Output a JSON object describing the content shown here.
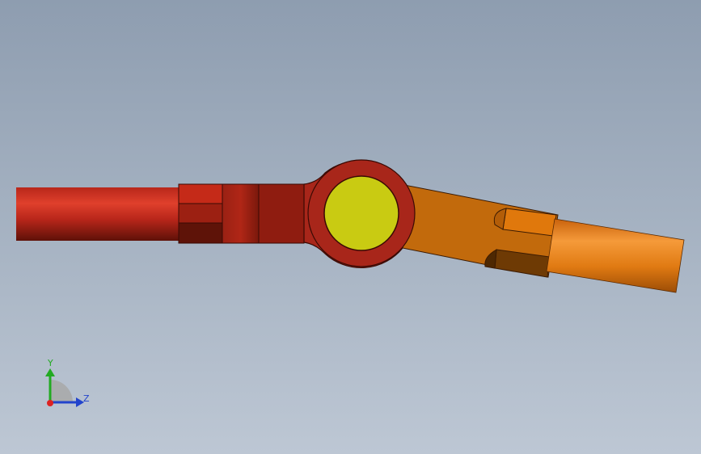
{
  "viewport": {
    "background_top": "#8e9db0",
    "background_bottom": "#bdc7d4"
  },
  "model": {
    "left_rod_color": "#c8281c",
    "left_clevis_color": "#a82316",
    "center_eye_color": "#a8261a",
    "ball_color": "#c9cb12",
    "right_link_color": "#c26a0c",
    "right_rod_color": "#e07a12"
  },
  "triad": {
    "y_label": "Y",
    "z_label": "Z",
    "y_color": "#22aa22",
    "z_color": "#2244cc",
    "origin_color": "#dd2222"
  }
}
